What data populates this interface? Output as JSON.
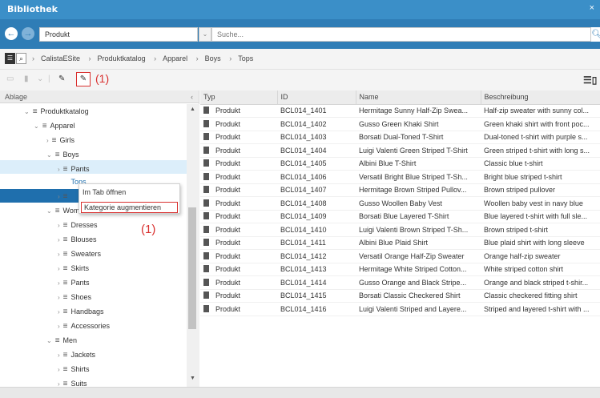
{
  "window": {
    "title": "Bibliothek",
    "close_glyph": "×"
  },
  "search": {
    "type_value": "Produkt",
    "placeholder": "Suche..."
  },
  "breadcrumb": [
    "CalistaESite",
    "Produktkatalog",
    "Apparel",
    "Boys",
    "Tops"
  ],
  "annotations": {
    "toolbar_label": "(1)",
    "menu_label": "(1)"
  },
  "left_panel": {
    "header": "Ablage",
    "tree": [
      {
        "label": "Produktkatalog",
        "level": 1,
        "expanded": true
      },
      {
        "label": "Apparel",
        "level": 2,
        "expanded": true
      },
      {
        "label": "Girls",
        "level": 3,
        "expanded": false
      },
      {
        "label": "Boys",
        "level": 3,
        "expanded": true,
        "selected": true
      },
      {
        "label": "Pants",
        "level": 4,
        "expanded": false
      },
      {
        "label": "Tops",
        "level": 4,
        "active": true
      },
      {
        "label": "",
        "level": 4
      },
      {
        "label": "Women",
        "level": 3,
        "expanded": true
      },
      {
        "label": "Dresses",
        "level": 4
      },
      {
        "label": "Blouses",
        "level": 4
      },
      {
        "label": "Sweaters",
        "level": 4
      },
      {
        "label": "Skirts",
        "level": 4
      },
      {
        "label": "Pants",
        "level": 4
      },
      {
        "label": "Shoes",
        "level": 4
      },
      {
        "label": "Handbags",
        "level": 4
      },
      {
        "label": "Accessories",
        "level": 4
      },
      {
        "label": "Men",
        "level": 3,
        "expanded": true
      },
      {
        "label": "Jackets",
        "level": 4
      },
      {
        "label": "Shirts",
        "level": 4
      },
      {
        "label": "Suits",
        "level": 4
      }
    ]
  },
  "context_menu": {
    "open_in_tab": "Im Tab öffnen",
    "augment": "Kategorie augmentieren"
  },
  "table": {
    "columns": [
      "Typ",
      "ID",
      "Name",
      "Beschreibung"
    ],
    "rows": [
      [
        "Produkt",
        "BCL014_1401",
        "Hermitage Sunny Half-Zip Swea...",
        "Half-zip sweater with sunny col..."
      ],
      [
        "Produkt",
        "BCL014_1402",
        "Gusso Green Khaki Shirt",
        "Green khaki shirt with front poc..."
      ],
      [
        "Produkt",
        "BCL014_1403",
        "Borsati Dual-Toned T-Shirt",
        "Dual-toned t-shirt with purple s..."
      ],
      [
        "Produkt",
        "BCL014_1404",
        "Luigi Valenti Green Striped T-Shirt",
        "Green striped t-shirt with long s..."
      ],
      [
        "Produkt",
        "BCL014_1405",
        "Albini Blue T-Shirt",
        "Classic blue t-shirt"
      ],
      [
        "Produkt",
        "BCL014_1406",
        "Versatil Bright Blue Striped T-Sh...",
        "Bright blue striped t-shirt"
      ],
      [
        "Produkt",
        "BCL014_1407",
        "Hermitage Brown Striped Pullov...",
        "Brown striped pullover"
      ],
      [
        "Produkt",
        "BCL014_1408",
        "Gusso Woollen Baby Vest",
        "Woollen baby vest in navy blue"
      ],
      [
        "Produkt",
        "BCL014_1409",
        "Borsati Blue Layered T-Shirt",
        "Blue layered t-shirt with full sle..."
      ],
      [
        "Produkt",
        "BCL014_1410",
        "Luigi Valenti Brown Striped T-Sh...",
        "Brown striped t-shirt"
      ],
      [
        "Produkt",
        "BCL014_1411",
        "Albini Blue Plaid Shirt",
        "Blue plaid shirt with long sleeve"
      ],
      [
        "Produkt",
        "BCL014_1412",
        "Versatil Orange Half-Zip Sweater",
        "Orange half-zip sweater"
      ],
      [
        "Produkt",
        "BCL014_1413",
        "Hermitage White Striped Cotton...",
        "White striped cotton shirt"
      ],
      [
        "Produkt",
        "BCL014_1414",
        "Gusso Orange and Black Stripe...",
        "Orange and black striped t-shir..."
      ],
      [
        "Produkt",
        "BCL014_1415",
        "Borsati Classic Checkered Shirt",
        "Classic checkered fitting shirt"
      ],
      [
        "Produkt",
        "BCL014_1416",
        "Luigi Valenti Striped and Layere...",
        "Striped and layered t-shirt with ..."
      ]
    ]
  },
  "colors": {
    "titlebar": "#3b8fc8",
    "searchrow": "#2f7db6",
    "highlight": "#d9302f",
    "selection": "#1f6fad"
  }
}
